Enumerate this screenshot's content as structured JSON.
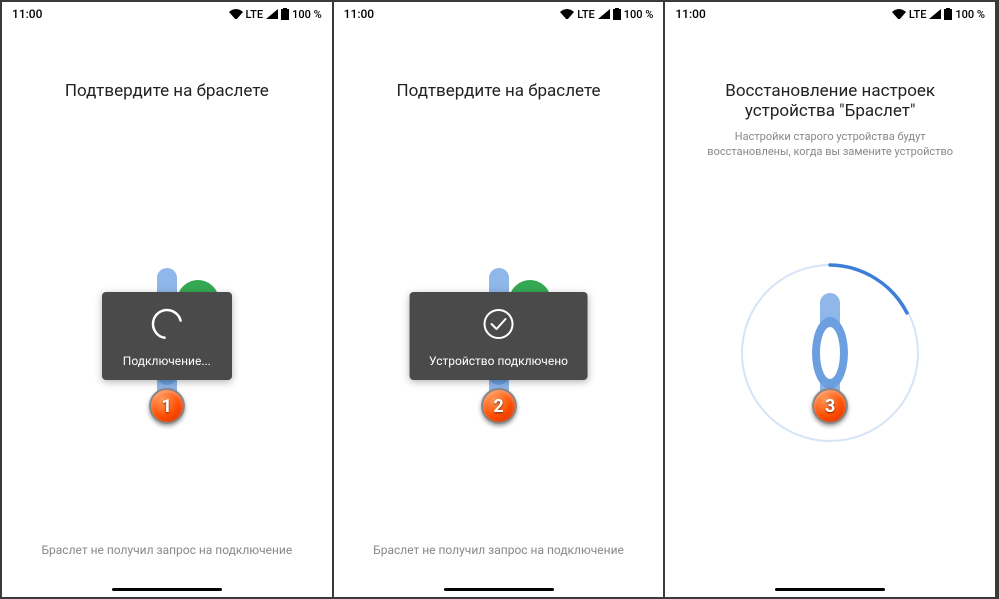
{
  "statusbar": {
    "time": "11:00",
    "network": "LTE",
    "battery": "100 %"
  },
  "screens": [
    {
      "title": "Подтвердите на браслете",
      "toast": "Подключение...",
      "footer": "Браслет не получил запрос на подключение",
      "step": "1"
    },
    {
      "title": "Подтвердите на браслете",
      "toast": "Устройство подключено",
      "footer": "Браслет не получил запрос на подключение",
      "step": "2"
    },
    {
      "title": "Восстановление настроек устройства \"Браслет\"",
      "subtitle": "Настройки старого устройства будут восстановлены, когда вы замените устройство",
      "step": "3"
    }
  ]
}
